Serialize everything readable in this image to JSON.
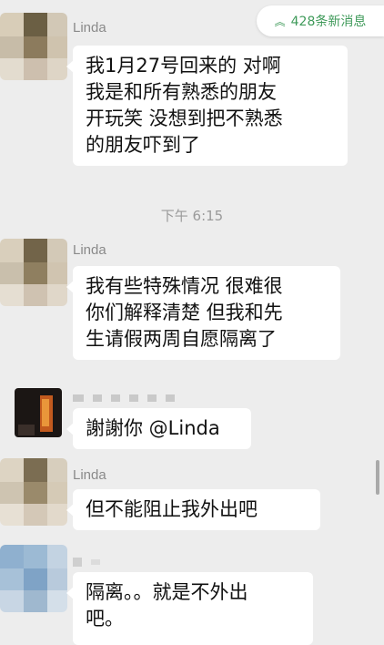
{
  "chat": {
    "new_messages": {
      "arrow": "︽",
      "label": "428条新消息",
      "color": "#3f9a5a"
    },
    "time_divider": "下午 6:15",
    "messages": [
      {
        "sender": "Linda",
        "lines": [
          "我1月27号回来的 对啊",
          "我是和所有熟悉的朋友",
          "开玩笑 没想到把不熟悉",
          "的朋友吓到了"
        ]
      },
      {
        "sender": "Linda",
        "lines": [
          "我有些特殊情况 很难很",
          "你们解释清楚 但我和先",
          "生请假两周自愿隔离了"
        ]
      },
      {
        "sender": "",
        "lines": [
          "謝謝你 @Linda"
        ]
      },
      {
        "sender": "Linda",
        "lines": [
          "但不能阻止我外出吧"
        ]
      },
      {
        "sender": "",
        "lines": [
          "隔离。。就是不外出",
          "吧。"
        ]
      }
    ]
  }
}
